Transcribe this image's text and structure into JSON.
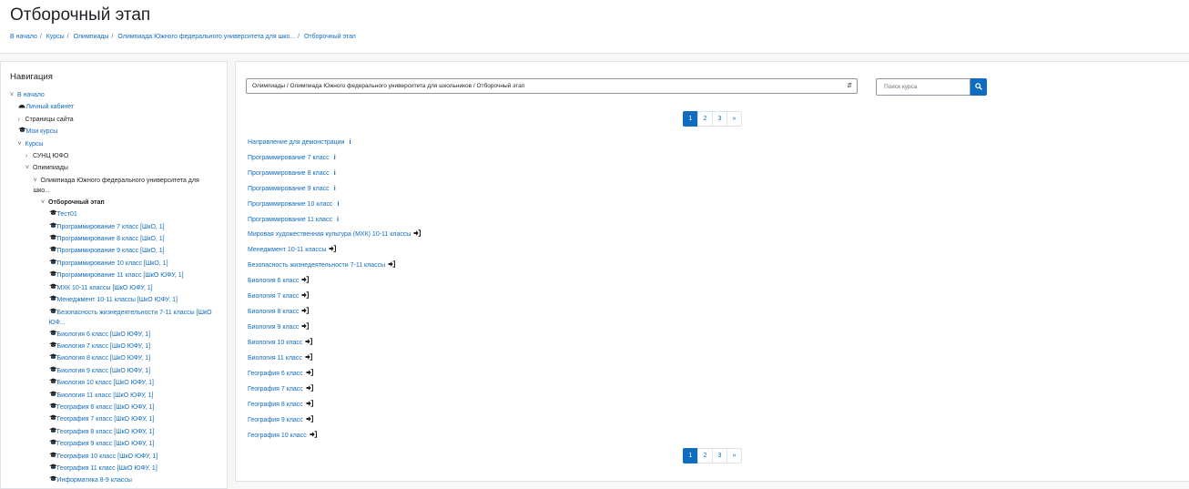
{
  "header": {
    "title": "Отборочный этап",
    "breadcrumb": [
      "В начало",
      "Курсы",
      "Олимпиады",
      "Олимпиада Южного федерального университета для шко...",
      "Отборочный этап"
    ]
  },
  "nav": {
    "title": "Навигация",
    "items": [
      {
        "label": "В начало",
        "level": 0,
        "chev": "down",
        "type": "link"
      },
      {
        "label": "Личный кабинет",
        "level": 1,
        "icon": "dashboard",
        "type": "link"
      },
      {
        "label": "Страницы сайта",
        "level": 1,
        "chev": "right",
        "type": "text"
      },
      {
        "label": "Мои курсы",
        "level": 1,
        "icon": "cap",
        "type": "link"
      },
      {
        "label": "Курсы",
        "level": 1,
        "chev": "down",
        "type": "link"
      },
      {
        "label": "СУНЦ ЮФО",
        "level": 2,
        "chev": "right",
        "type": "text"
      },
      {
        "label": "Олимпиады",
        "level": 2,
        "chev": "down",
        "type": "text"
      },
      {
        "label": "Олимпиада Южного федерального университета для шко...",
        "level": 3,
        "chev": "down",
        "type": "text",
        "wrap": true
      },
      {
        "label": "Отборочный этап",
        "level": 4,
        "chev": "down",
        "type": "text",
        "active": true
      },
      {
        "label": "Тест01",
        "level": 5,
        "icon": "cap",
        "type": "link"
      },
      {
        "label": "Программирование 7 класс [ШкО, 1]",
        "level": 5,
        "icon": "cap",
        "type": "link"
      },
      {
        "label": "Программирование 8 класс [ШкО, 1]",
        "level": 5,
        "icon": "cap",
        "type": "link"
      },
      {
        "label": "Программирование 9 класс [ШкО, 1]",
        "level": 5,
        "icon": "cap",
        "type": "link"
      },
      {
        "label": "Программирование 10 класс [ШкО, 1]",
        "level": 5,
        "icon": "cap",
        "type": "link"
      },
      {
        "label": "Программирование 11 класс [ШкО ЮФУ, 1]",
        "level": 5,
        "icon": "cap",
        "type": "link"
      },
      {
        "label": "МХК 10-11 классы [ШкО ЮФУ, 1]",
        "level": 5,
        "icon": "cap",
        "type": "link"
      },
      {
        "label": "Менеджмент 10-11 классы [ШкО ЮФУ, 1]",
        "level": 5,
        "icon": "cap",
        "type": "link"
      },
      {
        "label": "Безопасность жизнедеятельности 7-11 классы [ШкО ЮФ...",
        "level": 5,
        "icon": "cap",
        "type": "link",
        "wrap": true
      },
      {
        "label": "Биология 6 класс [ШкО ЮФУ, 1]",
        "level": 5,
        "icon": "cap",
        "type": "link"
      },
      {
        "label": "Биология 7 класс [ШкО ЮФУ, 1]",
        "level": 5,
        "icon": "cap",
        "type": "link"
      },
      {
        "label": "Биология 8 класс [ШкО ЮФУ, 1]",
        "level": 5,
        "icon": "cap",
        "type": "link"
      },
      {
        "label": "Биология 9 класс [ШкО ЮФУ, 1]",
        "level": 5,
        "icon": "cap",
        "type": "link"
      },
      {
        "label": "Биология 10 класс [ШкО ЮФУ, 1]",
        "level": 5,
        "icon": "cap",
        "type": "link"
      },
      {
        "label": "Биология 11 класс [ШкО ЮФУ, 1]",
        "level": 5,
        "icon": "cap",
        "type": "link"
      },
      {
        "label": "География 6 класс [ШкО ЮФУ, 1]",
        "level": 5,
        "icon": "cap",
        "type": "link"
      },
      {
        "label": "География 7 класс [ШкО ЮФУ, 1]",
        "level": 5,
        "icon": "cap",
        "type": "link"
      },
      {
        "label": "География 8 класс [ШкО ЮФУ, 1]",
        "level": 5,
        "icon": "cap",
        "type": "link"
      },
      {
        "label": "География 9 класс [ШкО ЮФУ, 1]",
        "level": 5,
        "icon": "cap",
        "type": "link"
      },
      {
        "label": "География 10 класс [ШкО ЮФУ, 1]",
        "level": 5,
        "icon": "cap",
        "type": "link"
      },
      {
        "label": "География 11 класс [ШкО ЮФУ, 1]",
        "level": 5,
        "icon": "cap",
        "type": "link"
      },
      {
        "label": "Информатика 8-9 классы",
        "level": 5,
        "icon": "cap",
        "type": "link"
      }
    ]
  },
  "main": {
    "category_select": "Олимпиады / Олимпиада Южного федерального университета для школьников / Отборочный этап",
    "search_placeholder": "Поиск курса",
    "pagination": [
      "1",
      "2",
      "3",
      "»"
    ],
    "active_page": "1",
    "courses": [
      {
        "name": "Направление для демонстрации",
        "icon": "info"
      },
      {
        "name": "Программирование 7 класс",
        "icon": "info"
      },
      {
        "name": "Программирование 8 класс",
        "icon": "info"
      },
      {
        "name": "Программирование 9 класс",
        "icon": "info"
      },
      {
        "name": "Программирование 10 класс",
        "icon": "info"
      },
      {
        "name": "Программирование 11 класс",
        "icon": "info"
      },
      {
        "name": "Мировая художественная культура (МХК) 10-11 классы",
        "icon": "enter"
      },
      {
        "name": "Менеджмент 10-11 классы",
        "icon": "enter"
      },
      {
        "name": "Безопасность жизнедеятельности 7-11 классы",
        "icon": "enter"
      },
      {
        "name": "Биология 6 класс",
        "icon": "enter"
      },
      {
        "name": "Биология 7 класс",
        "icon": "enter"
      },
      {
        "name": "Биология 8 класс",
        "icon": "enter"
      },
      {
        "name": "Биология 9 класс",
        "icon": "enter"
      },
      {
        "name": "Биология 10 класс",
        "icon": "enter"
      },
      {
        "name": "Биология 11 класс",
        "icon": "enter"
      },
      {
        "name": "География 6 класс",
        "icon": "enter"
      },
      {
        "name": "География 7 класс",
        "icon": "enter"
      },
      {
        "name": "География 8 класс",
        "icon": "enter"
      },
      {
        "name": "География 9 класс",
        "icon": "enter"
      },
      {
        "name": "География 10 класс",
        "icon": "enter"
      }
    ]
  },
  "colors": {
    "link": "#0f6cbf",
    "text": "#1d2125",
    "border": "#dee2e6"
  }
}
